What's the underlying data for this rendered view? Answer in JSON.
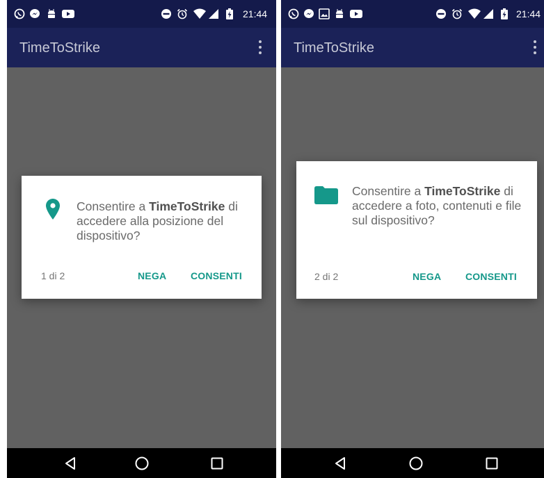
{
  "status_bar": {
    "time": "21:44"
  },
  "screens": [
    {
      "app_title": "TimeToStrike",
      "dialog": {
        "icon": "location-pin-icon",
        "text_prefix": "Consentire a ",
        "app_name": "TimeToStrike",
        "text_rest": " di accedere alla posizione del dispositivo?",
        "counter": "1 di 2",
        "deny_label": "NEGA",
        "allow_label": "CONSENTI"
      }
    },
    {
      "app_title": "TimeToStrike",
      "dialog": {
        "icon": "folder-icon",
        "text_prefix": "Consentire a ",
        "app_name": "TimeToStrike",
        "text_rest": " di accedere a foto, contenuti e file sul dispositivo?",
        "counter": "2 di 2",
        "deny_label": "NEGA",
        "allow_label": "CONSENTI"
      }
    }
  ],
  "colors": {
    "status_bar": "#141a4b",
    "app_bar": "#1b2258",
    "dim_overlay": "#616161",
    "accent": "#15988a",
    "nav_bar": "#000000"
  }
}
